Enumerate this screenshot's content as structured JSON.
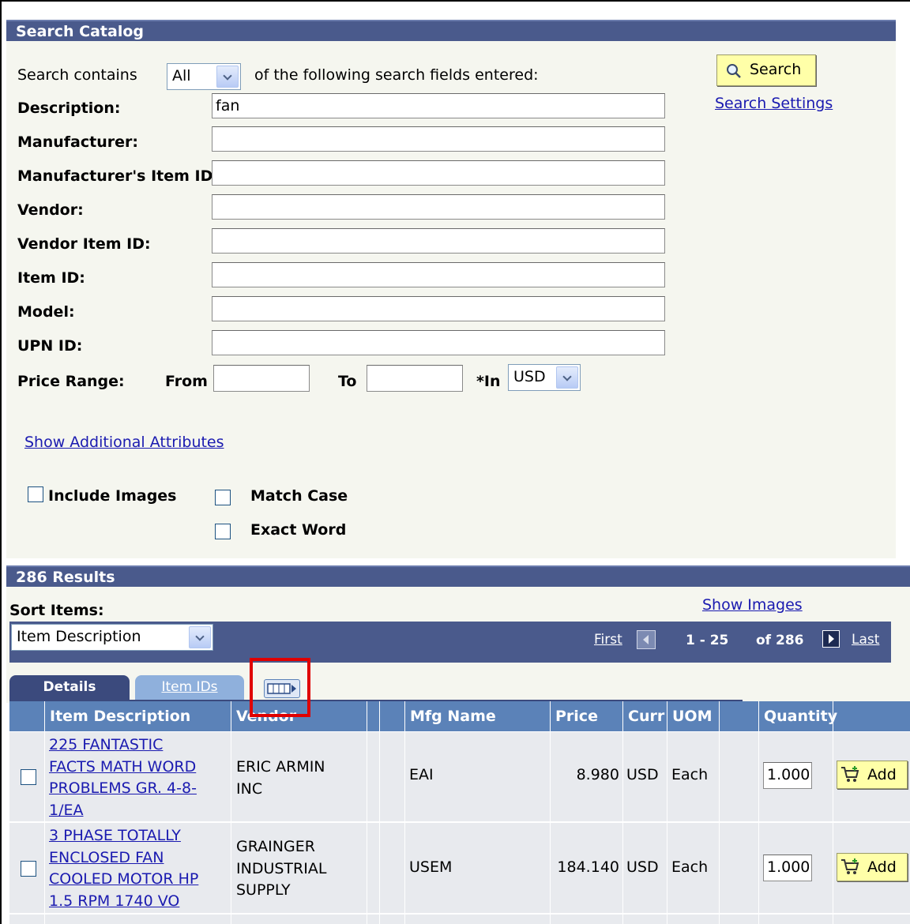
{
  "search_catalog": {
    "title": "Search Catalog",
    "search_contains_label": "Search contains",
    "search_contains_value": "All",
    "search_contains_suffix": "of the following search fields entered:",
    "search_button": "Search",
    "search_settings_link": "Search Settings",
    "fields": {
      "description_label": "Description:",
      "description_value": "fan",
      "manufacturer_label": "Manufacturer:",
      "mfr_item_id_label": "Manufacturer's Item ID:",
      "vendor_label": "Vendor:",
      "vendor_item_id_label": "Vendor Item ID:",
      "item_id_label": "Item ID:",
      "model_label": "Model:",
      "upn_id_label": "UPN ID:"
    },
    "price_range": {
      "label": "Price Range:",
      "from_label": "From",
      "to_label": "To",
      "in_label": "*In",
      "currency_value": "USD"
    },
    "show_additional_link": "Show Additional Attributes",
    "include_images_label": "Include Images",
    "match_case_label": "Match Case",
    "exact_word_label": "Exact Word"
  },
  "results": {
    "title": "286 Results",
    "sort_items_label": "Sort Items:",
    "sort_value": "Item Description",
    "show_images_link": "Show Images",
    "pager": {
      "first": "First",
      "range": "1 - 25",
      "of": "of 286",
      "last": "Last"
    },
    "tabs": {
      "details": "Details",
      "item_ids": "Item IDs"
    },
    "columns": [
      "Item Description",
      "Vendor",
      "",
      "",
      "Mfg Name",
      "Price",
      "Curr",
      "UOM",
      "",
      "Quantity",
      ""
    ],
    "rows": [
      {
        "desc_lines": [
          "225 FANTASTIC",
          "FACTS MATH WORD",
          "PROBLEMS GR. 4-8-",
          "1/EA"
        ],
        "vendor_lines": [
          "ERIC ARMIN",
          "INC"
        ],
        "mfg": "EAI",
        "price": "8.980",
        "curr": "USD",
        "uom": "Each",
        "qty": "1.000",
        "add": "Add"
      },
      {
        "desc_lines": [
          "3 PHASE TOTALLY",
          "ENCLOSED FAN",
          "COOLED MOTOR HP",
          "1.5 RPM 1740 VO"
        ],
        "vendor_lines": [
          "GRAINGER",
          "INDUSTRIAL",
          "SUPPLY"
        ],
        "mfg": "USEM",
        "price": "184.140",
        "curr": "USD",
        "uom": "Each",
        "qty": "1.000",
        "add": "Add"
      }
    ]
  },
  "colors": {
    "header_bar": "#4a5a8c",
    "panel_bg": "#f5f6ef",
    "grid_header": "#5b82b8",
    "link": "#1a1ab0",
    "button_bg": "#ffffa8",
    "highlight_box": "#e00000"
  }
}
